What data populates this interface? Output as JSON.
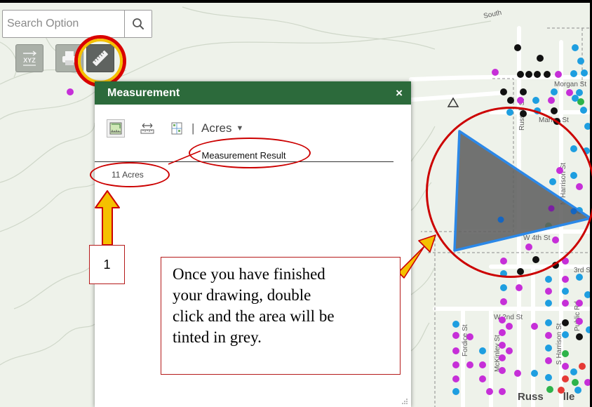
{
  "colors": {
    "header_green": "#2c6a3b",
    "annotation_red": "#cc0000",
    "arrow_yellow": "#f5c000",
    "polygon_fill": "#606060",
    "polygon_edge": "#2b88e8"
  },
  "search": {
    "placeholder": "Search Option",
    "icon": "search-icon"
  },
  "toolbar": {
    "tools": [
      {
        "name": "xyz-coordinates-tool",
        "label": "XYZ",
        "active": false
      },
      {
        "name": "print-tool",
        "active": false
      },
      {
        "name": "measure-tool",
        "active": true
      }
    ]
  },
  "panel": {
    "title": "Measurement",
    "close_label": "×",
    "tools": [
      "area-icon",
      "distance-icon",
      "location-icon"
    ],
    "separator": "|",
    "unit": "Acres",
    "result_header": "Measurement Result",
    "result_value": "11 Acres"
  },
  "map": {
    "streets": [
      "Morgan St",
      "Marion St",
      "N Harrison St",
      "W 4th St",
      "3rd S",
      "W 2nd St",
      "Public Rd",
      "S Harrison St",
      "McKinley St",
      "Fordice St",
      "Russell St",
      "South"
    ],
    "town": "Russellville",
    "town_shown": "Russ",
    "town_tail": "lle"
  },
  "annotations": {
    "step_number": "1",
    "instruction_lines": [
      "Once you have finished",
      "your drawing, double",
      "click and the area will be",
      "tinted in grey."
    ]
  }
}
